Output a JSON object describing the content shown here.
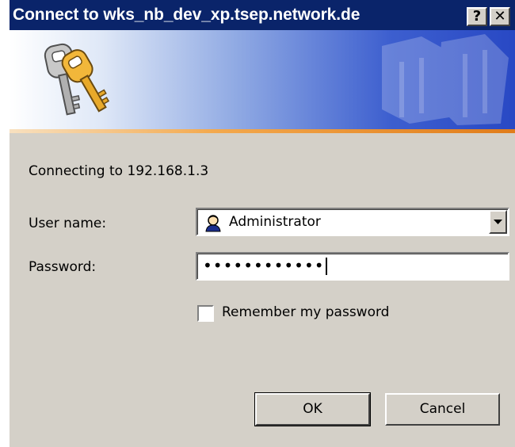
{
  "window": {
    "title": "Connect to wks_nb_dev_xp.tsep.network.de",
    "help_label": "?",
    "close_label": "✕"
  },
  "icons": {
    "banner": "keys-icon",
    "user": "user-icon",
    "dropdown": "chevron-down-icon"
  },
  "colors": {
    "titlebar": "#0a246a",
    "banner_accent": "#2848c4",
    "stripe": "#e07c1a",
    "dialog_bg": "#d4d0c8"
  },
  "content": {
    "connecting_text": "Connecting to 192.168.1.3"
  },
  "form": {
    "username_label": "User name:",
    "username_value": "Administrator",
    "password_label": "Password:",
    "password_value": "••••••••••••",
    "remember_label": "Remember my password",
    "remember_checked": false
  },
  "buttons": {
    "ok_label": "OK",
    "cancel_label": "Cancel"
  }
}
